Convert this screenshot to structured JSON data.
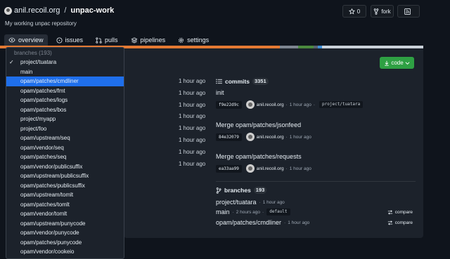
{
  "repo": {
    "owner": "anil.recoil.org",
    "separator": "/",
    "name": "unpac-work",
    "description": "My working unpac repository"
  },
  "header_buttons": {
    "star_count": "0",
    "fork_label": "fork"
  },
  "tabs": [
    {
      "label": "overview",
      "icon": "eye-icon",
      "active": true
    },
    {
      "label": "issues",
      "icon": "issue-icon"
    },
    {
      "label": "pulls",
      "icon": "pull-request-icon"
    },
    {
      "label": "pipelines",
      "icon": "layers-icon"
    },
    {
      "label": "settings",
      "icon": "gear-icon"
    }
  ],
  "language_colors": [
    "#e37933",
    "#7d8590",
    "#4b8a3e",
    "#5a6270",
    "#3f8fd8",
    "#c9d1d9"
  ],
  "code_button": {
    "label": "code"
  },
  "file_times": [
    "1 hour ago",
    "1 hour ago",
    "1 hour ago",
    "1 hour ago",
    "1 hour ago",
    "1 hour ago",
    "1 hour ago",
    "1 hour ago"
  ],
  "commits": {
    "label": "commits",
    "count": "3351",
    "items": [
      {
        "message": "init",
        "sha": "f9e22d9c",
        "author": "anil.recoil.org",
        "sep": "·",
        "time": "1 hour ago",
        "sep2": "·",
        "branch": "project/tuatara"
      },
      {
        "message": "Merge opam/patches/jsonfeed",
        "sha": "84e32079",
        "author": "anil.recoil.org",
        "sep": "·",
        "time": "1 hour ago"
      },
      {
        "message": "Merge opam/patches/requests",
        "sha": "ea33aa99",
        "author": "anil.recoil.org",
        "sep": "·",
        "time": "1 hour ago"
      }
    ]
  },
  "branches": {
    "label": "branches",
    "count": "193",
    "items": [
      {
        "name": "project/tuatara",
        "sep": "·",
        "time": "1 hour ago"
      },
      {
        "name": "main",
        "sep": "·",
        "time": "2 hours ago",
        "sep2": "·",
        "tag": "default",
        "compare": "compare"
      },
      {
        "name": "opam/patches/cmdliner",
        "sep": "·",
        "time": "1 hour ago",
        "compare": "compare"
      }
    ]
  },
  "dropdown": {
    "header": "branches (193)",
    "check_glyph": "✓",
    "items": [
      "project/tuatara",
      "main",
      "opam/patches/cmdliner",
      "opam/patches/fmt",
      "opam/patches/logs",
      "opam/patches/bos",
      "project/myapp",
      "project/foo",
      "opam/upstream/seq",
      "opam/vendor/seq",
      "opam/patches/seq",
      "opam/vendor/publicsuffix",
      "opam/upstream/publicsuffix",
      "opam/patches/publicsuffix",
      "opam/upstream/tomlt",
      "opam/patches/tomlt",
      "opam/vendor/tomlt",
      "opam/upstream/punycode",
      "opam/vendor/punycode",
      "opam/patches/punycode",
      "opam/vendor/cookeio"
    ],
    "checked_index": 0,
    "selected_index": 2
  }
}
